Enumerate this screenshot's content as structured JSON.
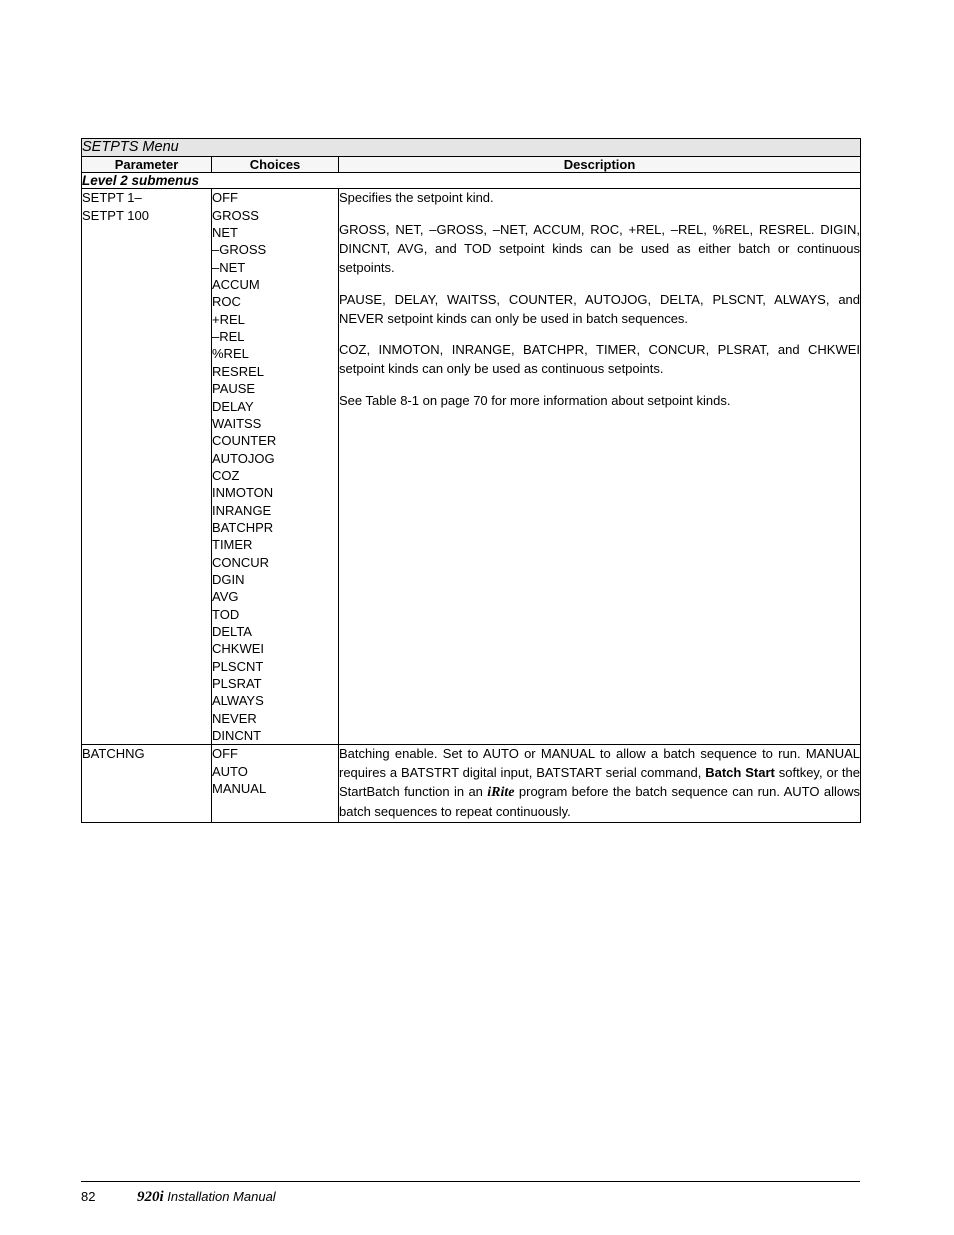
{
  "table": {
    "title": "SETPTS Menu",
    "columns": {
      "parameter": "Parameter",
      "choices": "Choices",
      "description": "Description"
    },
    "section_label": "Level 2 submenus",
    "rows": [
      {
        "parameter_lines": [
          "SETPT 1–",
          "SETPT 100"
        ],
        "choices": [
          "OFF",
          "GROSS",
          "NET",
          "–GROSS",
          "–NET",
          "ACCUM",
          "ROC",
          "+REL",
          "–REL",
          "%REL",
          "RESREL",
          "PAUSE",
          "DELAY",
          "WAITSS",
          "COUNTER",
          "AUTOJOG",
          "COZ",
          "INMOTON",
          "INRANGE",
          "BATCHPR",
          "TIMER",
          "CONCUR",
          "DGIN",
          "AVG",
          "TOD",
          "DELTA",
          "CHKWEI",
          "PLSCNT",
          "PLSRAT",
          "ALWAYS",
          "NEVER",
          "DINCNT"
        ],
        "description_paragraphs": [
          "Specifies the setpoint kind.",
          "GROSS, NET, –GROSS, –NET, ACCUM, ROC, +REL, –REL, %REL, RESREL. DIGIN, DINCNT, AVG, and TOD setpoint kinds can be used as either batch or continuous setpoints.",
          "PAUSE, DELAY, WAITSS, COUNTER, AUTOJOG, DELTA, PLSCNT, ALWAYS, and NEVER setpoint kinds can only be used in batch sequences.",
          "COZ, INMOTON, INRANGE, BATCHPR, TIMER, CONCUR, PLSRAT, and CHKWEI setpoint kinds can only be used as continuous setpoints.",
          "See Table 8-1 on page 70 for more information about setpoint kinds."
        ]
      },
      {
        "parameter_lines": [
          "BATCHNG"
        ],
        "choices": [
          "OFF",
          "AUTO",
          "MANUAL"
        ],
        "description_rich": {
          "part1": "Batching enable. Set to AUTO or MANUAL to allow a batch sequence to run. MANUAL requires a BATSTRT digital input, BATSTART serial command, ",
          "bold1": "Batch Start",
          "part2": " softkey, or the StartBatch function in an ",
          "italic1": "iRite",
          "part3": " program before the batch sequence can run. AUTO allows batch sequences to repeat continuously."
        }
      }
    ]
  },
  "footer": {
    "page_number": "82",
    "model": "920i",
    "manual_title": " Installation Manual"
  }
}
